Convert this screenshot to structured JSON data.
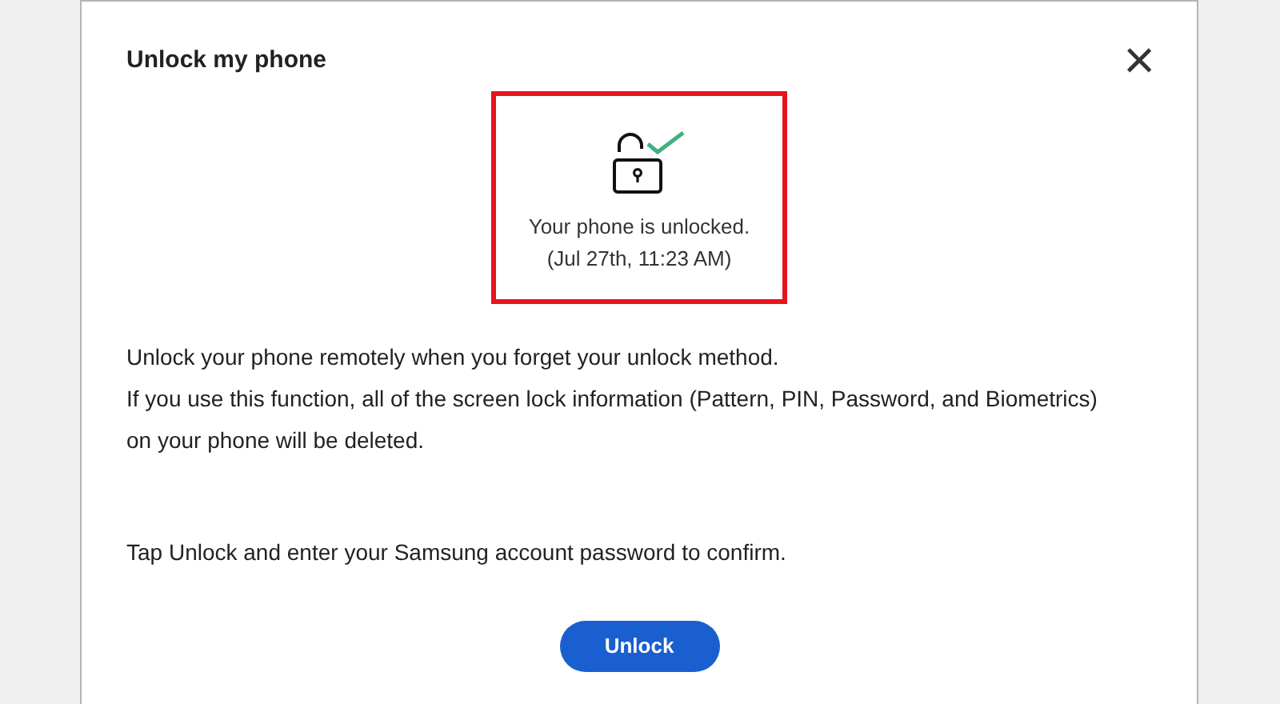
{
  "dialog": {
    "title": "Unlock my phone",
    "close": "×"
  },
  "status": {
    "highlighted": true,
    "message": "Your phone is unlocked.",
    "time": "(Jul 27th, 11:23 AM)"
  },
  "paragraphs": [
    "Unlock your phone remotely when you forget your unlock method.",
    "If you use this function, all of the screen lock information (Pattern, PIN, Password, and Biometrics) on your phone will be deleted."
  ],
  "instruction": "Tap Unlock and enter your Samsung account password to confirm.",
  "button": {
    "label": "Unlock"
  }
}
